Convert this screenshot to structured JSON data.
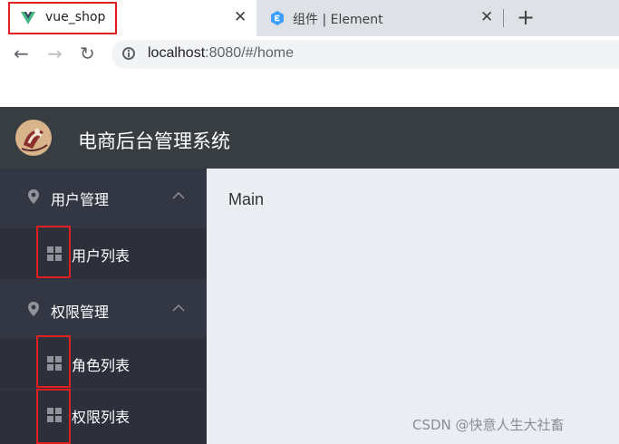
{
  "browser": {
    "tabs": [
      {
        "title": "vue_shop",
        "favicon": "vue-logo-icon",
        "active": true
      },
      {
        "title": "组件 | Element",
        "favicon": "element-logo-icon",
        "active": false
      }
    ],
    "close_glyph": "✕",
    "new_tab_glyph": "+",
    "nav": {
      "back": "←",
      "forward": "→",
      "reload": "↻"
    },
    "url_host": "localhost",
    "url_rest": ":8080/#/home"
  },
  "app": {
    "title": "电商后台管理系统",
    "header_color": "#373d41",
    "aside_color": "#333744",
    "main_color": "#eaedf1"
  },
  "sidebar": {
    "menus": [
      {
        "label": "用户管理",
        "icon": "location-pin-icon",
        "expanded": true,
        "items": [
          {
            "label": "用户列表",
            "icon": "grid-menu-icon"
          }
        ]
      },
      {
        "label": "权限管理",
        "icon": "location-pin-icon",
        "expanded": true,
        "items": [
          {
            "label": "角色列表",
            "icon": "grid-menu-icon"
          },
          {
            "label": "权限列表",
            "icon": "grid-menu-icon"
          }
        ]
      }
    ]
  },
  "main": {
    "text": "Main"
  },
  "watermark": "CSDN @快意人生大社畜",
  "annotation_color": "#e02020"
}
